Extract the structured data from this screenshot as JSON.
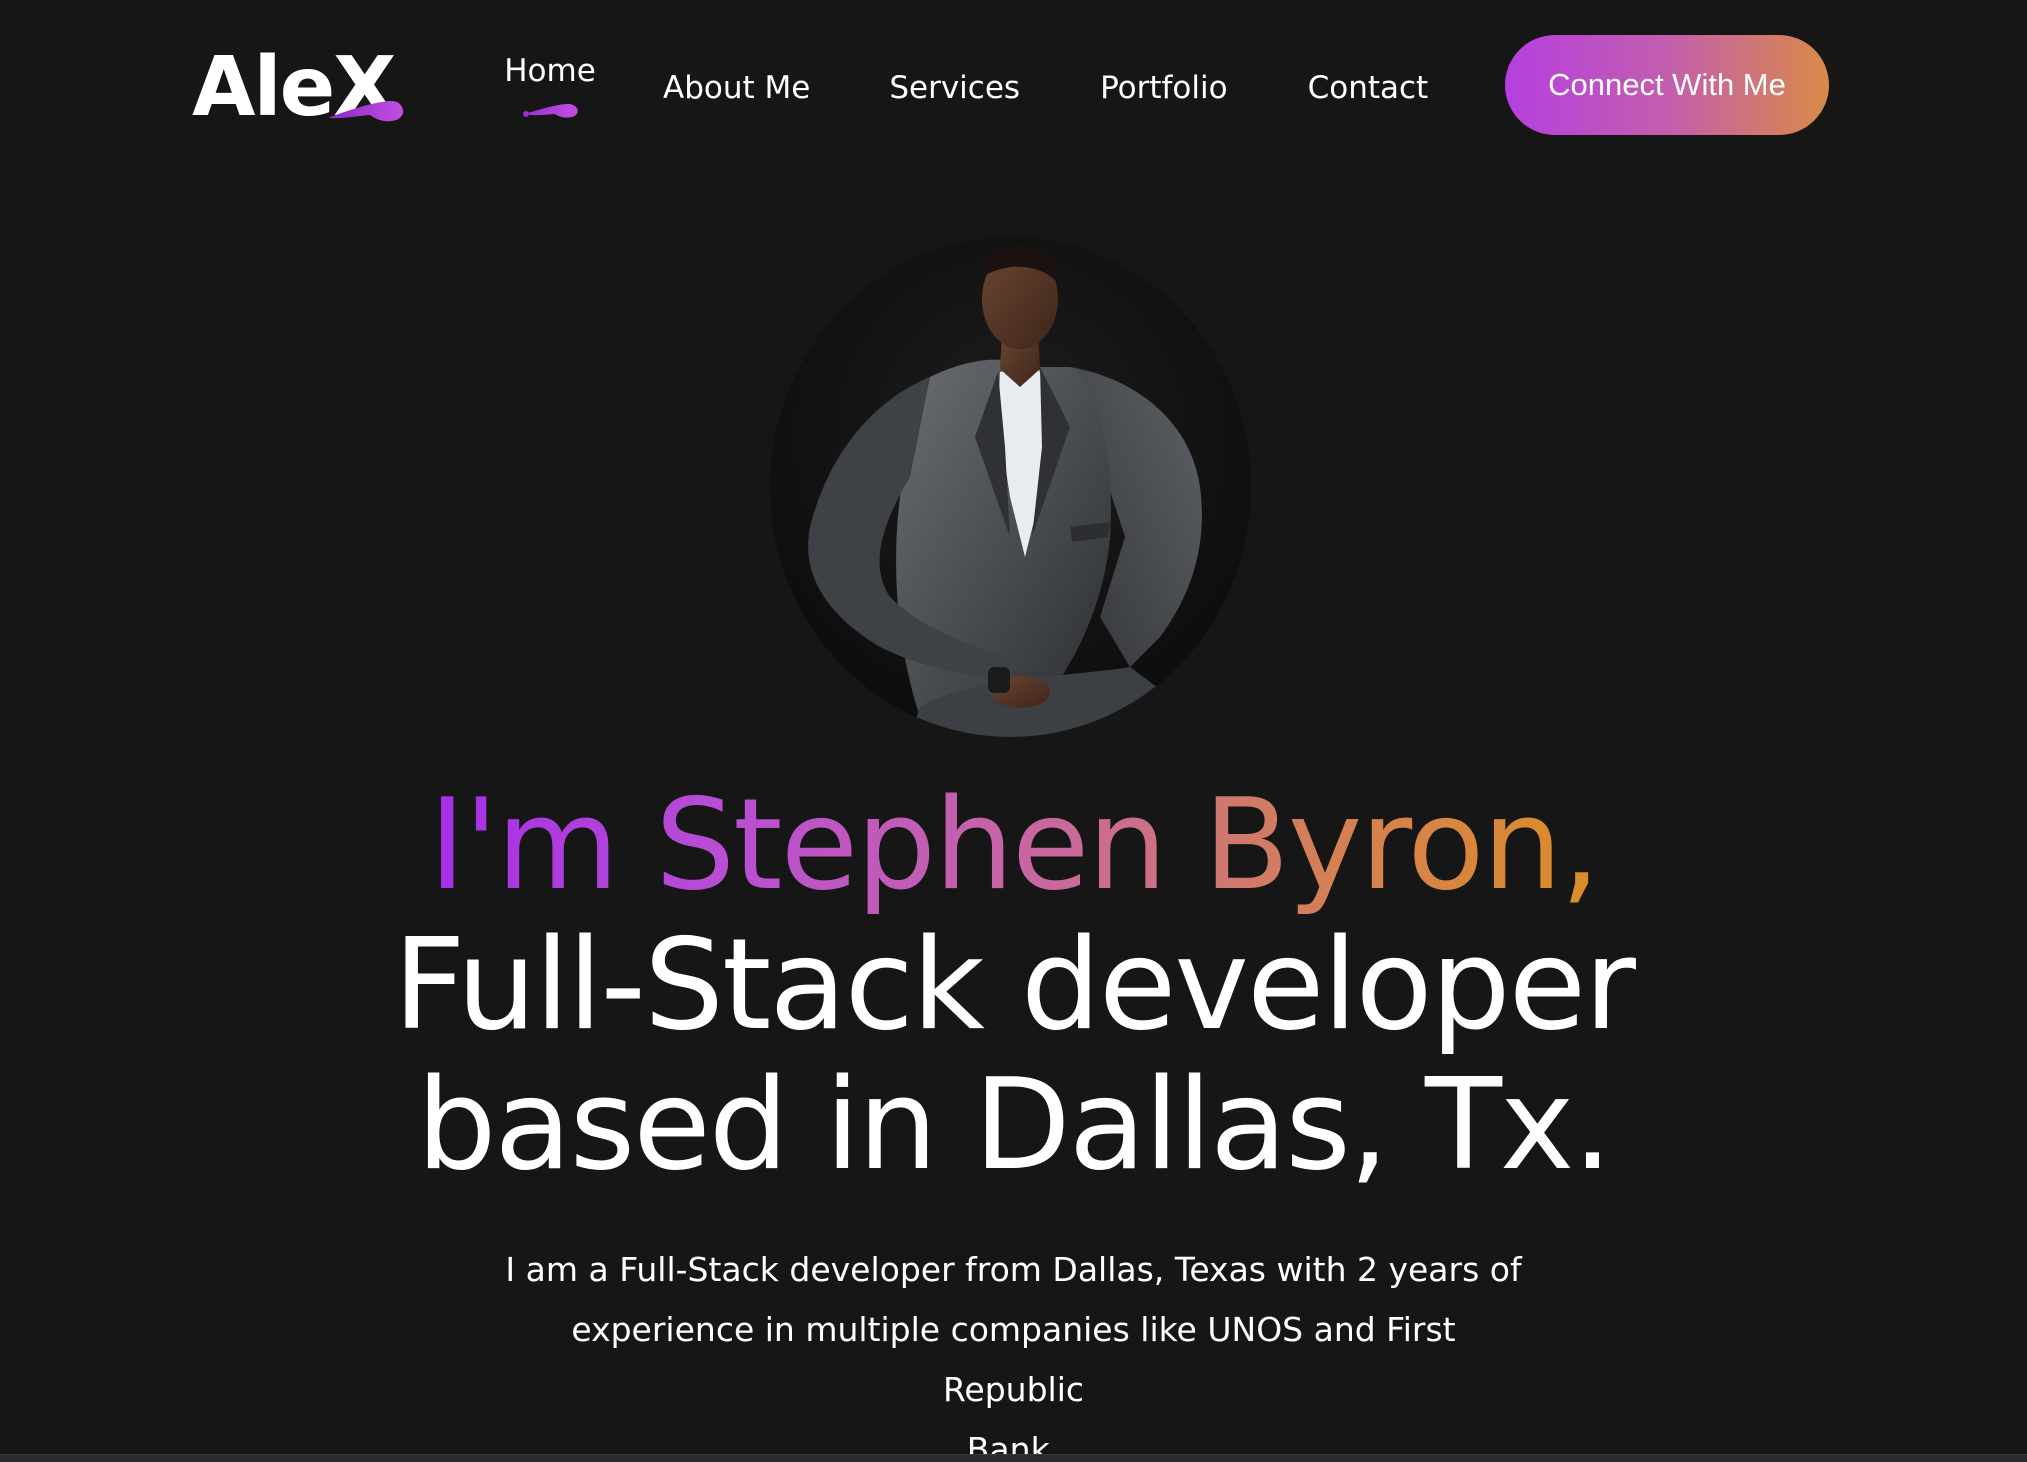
{
  "header": {
    "logo_text": "AleX",
    "nav": {
      "home": "Home",
      "about": "About Me",
      "services": "Services",
      "portfolio": "Portfolio",
      "contact": "Contact"
    },
    "cta_label": "Connect With Me"
  },
  "hero": {
    "headline_line1": "I'm Stephen Byron,",
    "headline_line2": "Full-Stack developer",
    "headline_line3": "based in Dallas, Tx.",
    "intro_line1": "I am a Full-Stack developer from Dallas, Texas with 2 years of",
    "intro_line2": "experience in multiple companies like UNOS and First Republic",
    "intro_line3": "Bank."
  },
  "colors": {
    "background": "#161616",
    "accent_purple": "#b63fe0",
    "accent_orange": "#d98a47",
    "text": "#ffffff"
  },
  "icons": {
    "logo_swoosh": "swoosh-icon",
    "active_nav_indicator": "swoosh-indicator-icon"
  }
}
